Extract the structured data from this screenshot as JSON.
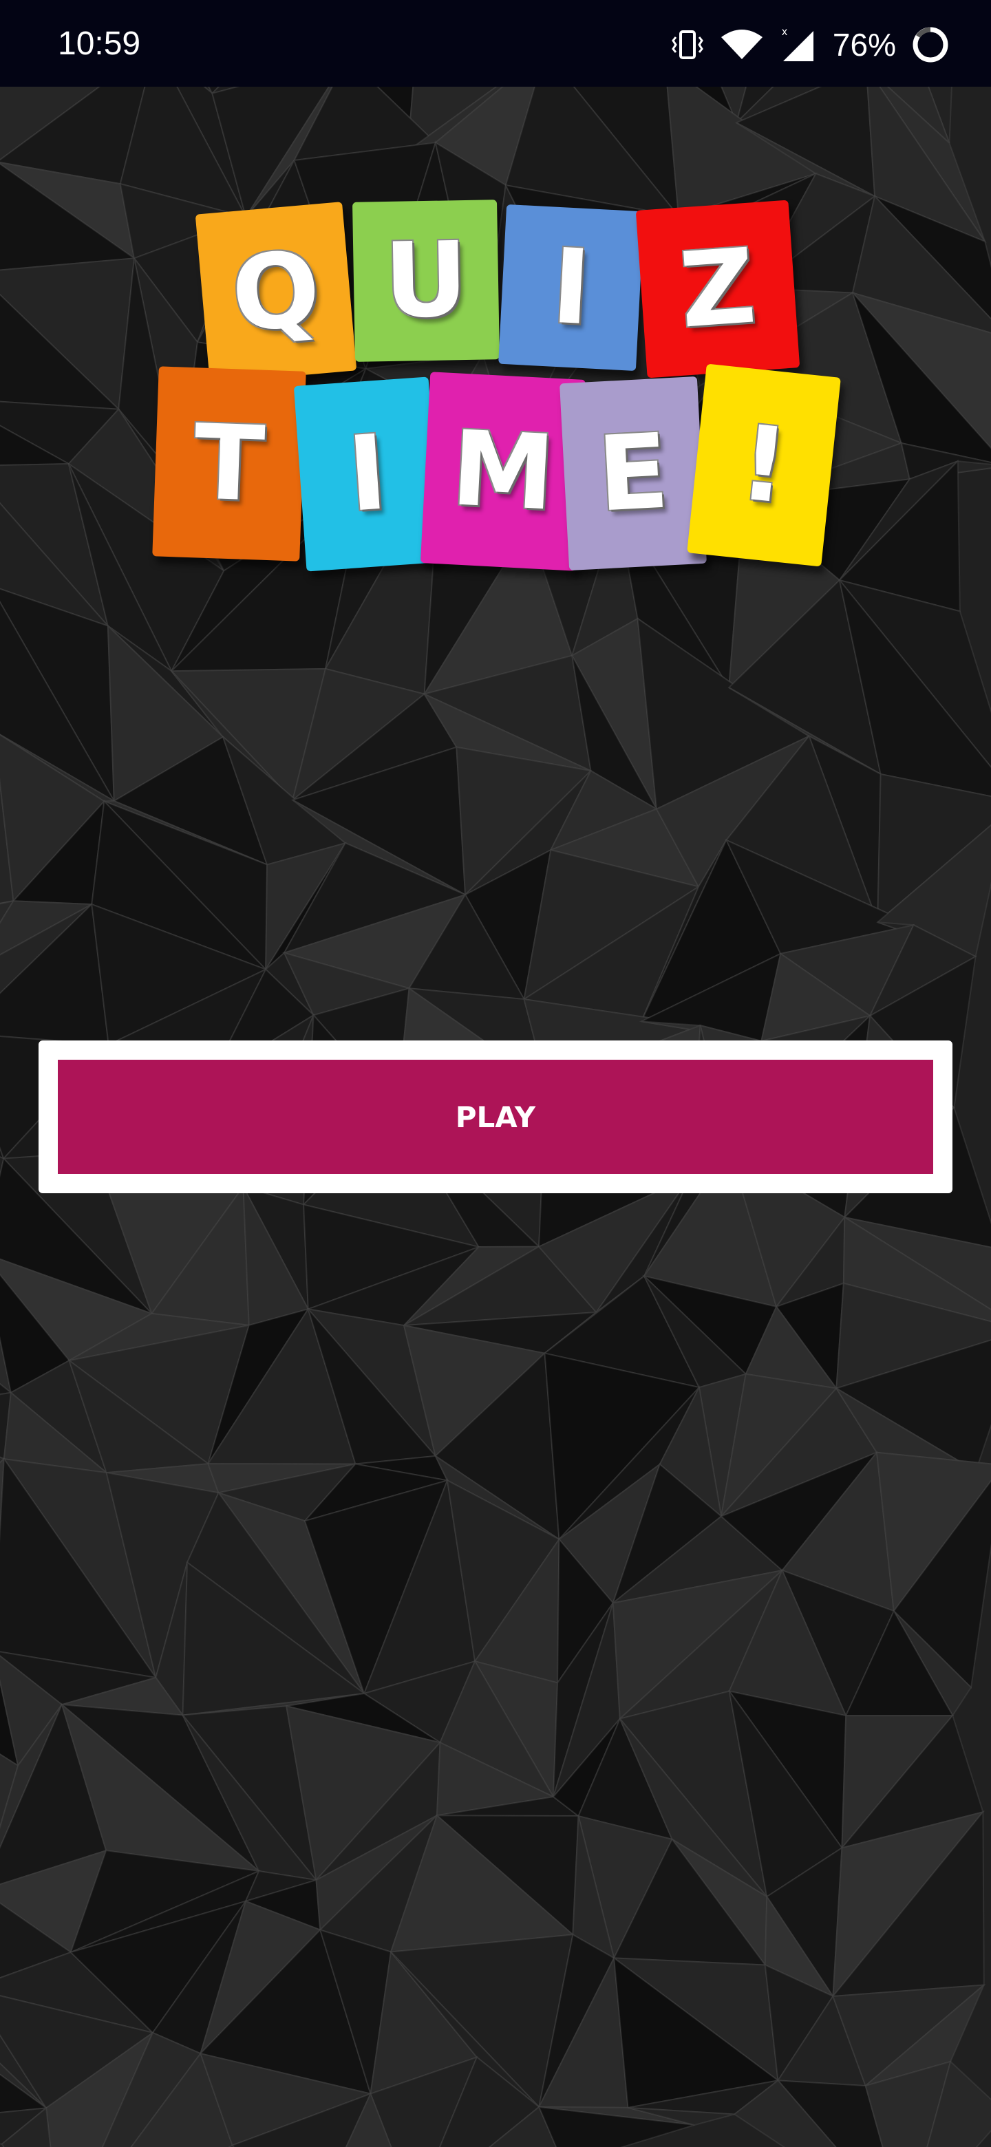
{
  "status_bar": {
    "time": "10:59",
    "battery": "76%",
    "icons": [
      "vibrate-icon",
      "wifi-icon",
      "signal-icon",
      "battery-icon"
    ]
  },
  "logo": {
    "row1": [
      {
        "letter": "Q",
        "color": "#f9a81b"
      },
      {
        "letter": "U",
        "color": "#8ccf4f"
      },
      {
        "letter": "I",
        "color": "#5a8fd8"
      },
      {
        "letter": "Z",
        "color": "#f20f0f"
      }
    ],
    "row2": [
      {
        "letter": "T",
        "color": "#e8680c"
      },
      {
        "letter": "I",
        "color": "#22c0e6"
      },
      {
        "letter": "M",
        "color": "#e021ae"
      },
      {
        "letter": "E",
        "color": "#a99ccc"
      },
      {
        "letter": "!",
        "color": "#ffe000"
      }
    ]
  },
  "play_button": {
    "label": "PLAY",
    "color": "#ad1457"
  },
  "background_color": "#1c1c1c"
}
